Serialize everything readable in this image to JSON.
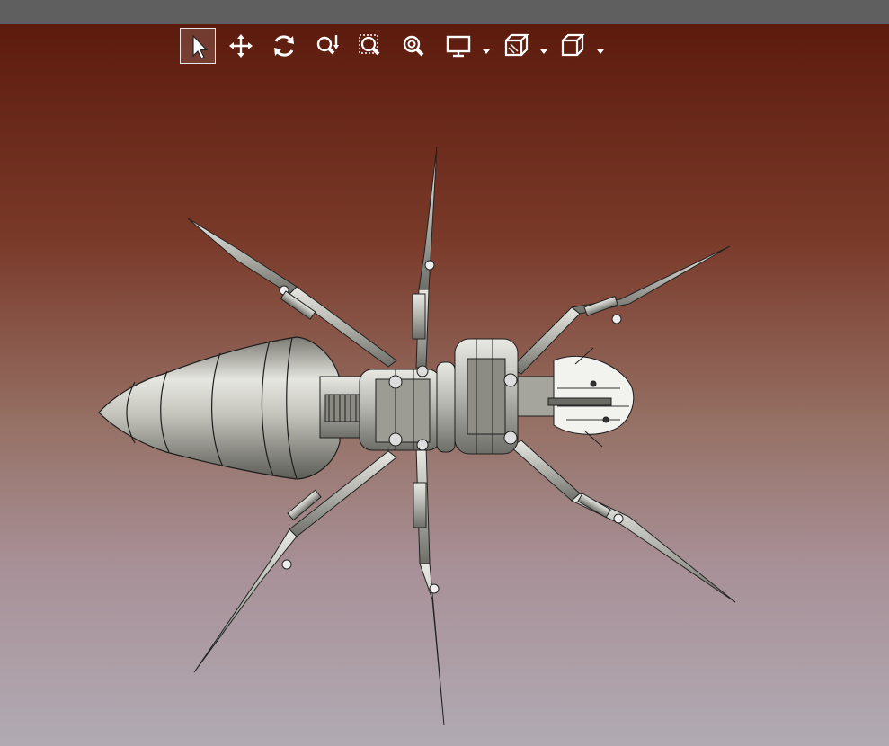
{
  "window": {
    "title_bar_color": "#5f5f5f"
  },
  "viewport": {
    "background_top": "#5c1b0d",
    "background_bottom": "#b1aab3",
    "model": "mechanical-spider-assembly"
  },
  "toolbar": {
    "buttons": [
      {
        "id": "select",
        "icon": "select-arrow-icon",
        "active": true
      },
      {
        "id": "pan",
        "icon": "pan-move-icon",
        "active": false
      },
      {
        "id": "rotate",
        "icon": "rotate-icon",
        "active": false
      },
      {
        "id": "zoom",
        "icon": "zoom-in-out-icon",
        "active": false
      },
      {
        "id": "zoom-window",
        "icon": "zoom-window-icon",
        "active": false
      },
      {
        "id": "zoom-fit",
        "icon": "zoom-fit-icon",
        "active": false
      },
      {
        "id": "display-mode",
        "icon": "monitor-icon",
        "dropdown": true
      },
      {
        "id": "section",
        "icon": "section-cut-icon",
        "dropdown": true
      },
      {
        "id": "view-orientation",
        "icon": "cube-view-icon",
        "dropdown": true
      }
    ]
  }
}
